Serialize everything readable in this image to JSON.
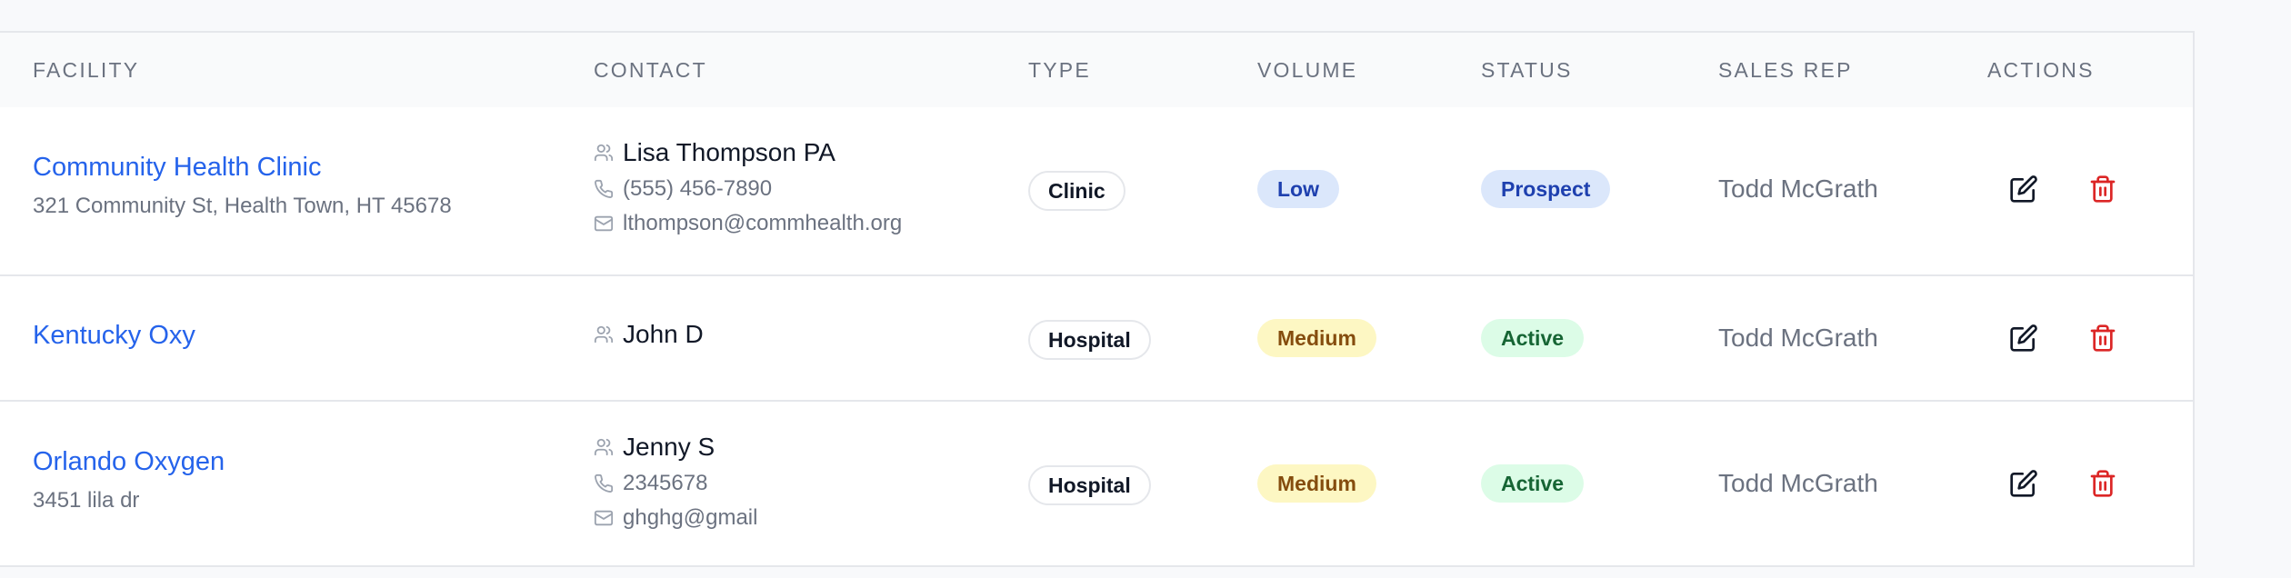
{
  "table": {
    "headers": {
      "facility": "FACILITY",
      "contact": "CONTACT",
      "type": "TYPE",
      "volume": "VOLUME",
      "status": "STATUS",
      "sales_rep": "SALES REP",
      "actions": "ACTIONS"
    },
    "rows": [
      {
        "facility_name": "Community Health Clinic",
        "facility_address": "321 Community St, Health Town, HT 45678",
        "contact_name": "Lisa Thompson PA",
        "contact_phone": "(555) 456-7890",
        "contact_email": "lthompson@commhealth.org",
        "type": "Clinic",
        "volume": "Low",
        "status": "Prospect",
        "sales_rep": "Todd McGrath"
      },
      {
        "facility_name": "Kentucky Oxy",
        "contact_name": "John D",
        "type": "Hospital",
        "volume": "Medium",
        "status": "Active",
        "sales_rep": "Todd McGrath"
      },
      {
        "facility_name": "Orlando Oxygen",
        "facility_address": "3451 lila dr",
        "contact_name": "Jenny S",
        "contact_phone": "2345678",
        "contact_email": "ghghg@gmail",
        "type": "Hospital",
        "volume": "Medium",
        "status": "Active",
        "sales_rep": "Todd McGrath"
      }
    ]
  },
  "icons": {
    "contact": "users-icon",
    "phone": "phone-icon",
    "email": "mail-icon",
    "edit": "edit-icon",
    "delete": "trash-icon"
  },
  "colors": {
    "link": "#2563eb",
    "delete": "#dc2626",
    "low_bg": "#dbe7fb",
    "medium_bg": "#fdf7c3",
    "active_bg": "#dcfce7"
  }
}
